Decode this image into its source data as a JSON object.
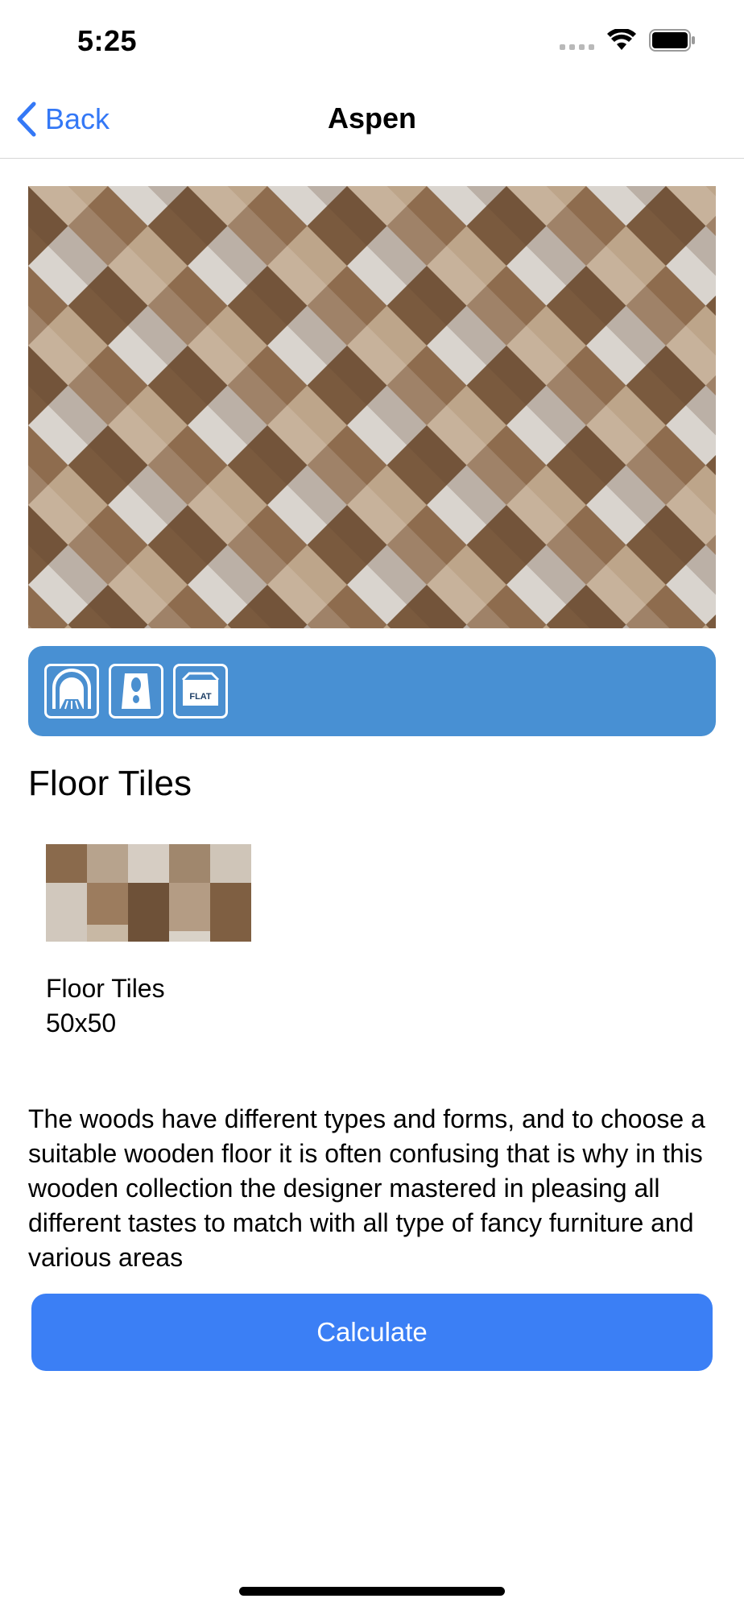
{
  "status_bar": {
    "time": "5:25"
  },
  "nav": {
    "back_label": "Back",
    "title": "Aspen"
  },
  "feature_icons": [
    "indoor-use-icon",
    "floor-use-icon",
    "flat-finish-icon"
  ],
  "feature_icon_flat_text": "FLAT",
  "section": {
    "title": "Floor Tiles",
    "thumbnail_name": "Floor Tiles",
    "thumbnail_size": "50x50"
  },
  "description": "The woods have different types and forms, and to choose a suitable wooden floor it is often confusing that is why in this wooden collection the designer mastered in pleasing all different tastes to match with all type of fancy furniture and various areas",
  "actions": {
    "calculate_label": "Calculate"
  },
  "colors": {
    "accent": "#3478f6",
    "feature_bar": "#4890d3",
    "button": "#3b7ff5"
  }
}
